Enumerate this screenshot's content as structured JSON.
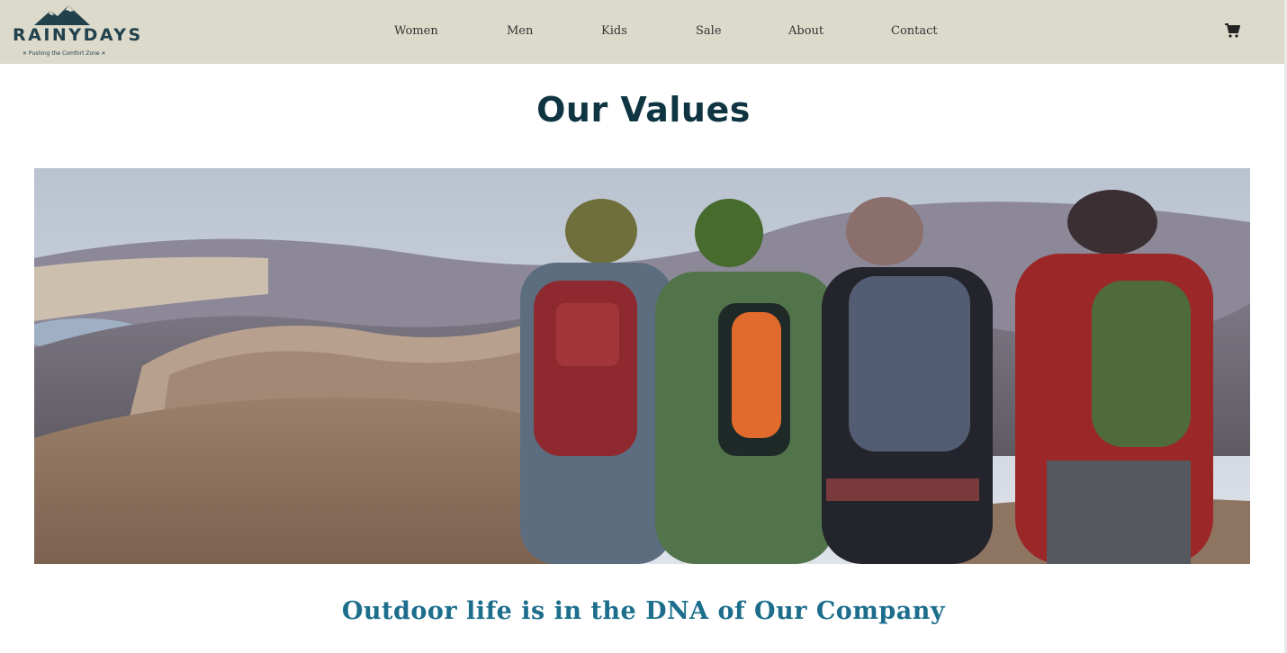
{
  "header": {
    "logo": {
      "wordmark": "RAINYDAYS",
      "tagline": "✕ Pushing the Comfort Zone ✕"
    },
    "nav": [
      {
        "label": "Women"
      },
      {
        "label": "Men"
      },
      {
        "label": "Kids"
      },
      {
        "label": "Sale"
      },
      {
        "label": "About"
      },
      {
        "label": "Contact"
      }
    ],
    "cart_icon": "shopping-cart-icon"
  },
  "main": {
    "title": "Our Values",
    "hero_image": "four hikers with backpacks overlooking mountain valley",
    "subtitle": "Outdoor life is in the DNA of Our Company"
  },
  "colors": {
    "header_bg": "#dcdacb",
    "title": "#0f3442",
    "subtitle": "#1c6e8c",
    "logo": "#21414c"
  }
}
